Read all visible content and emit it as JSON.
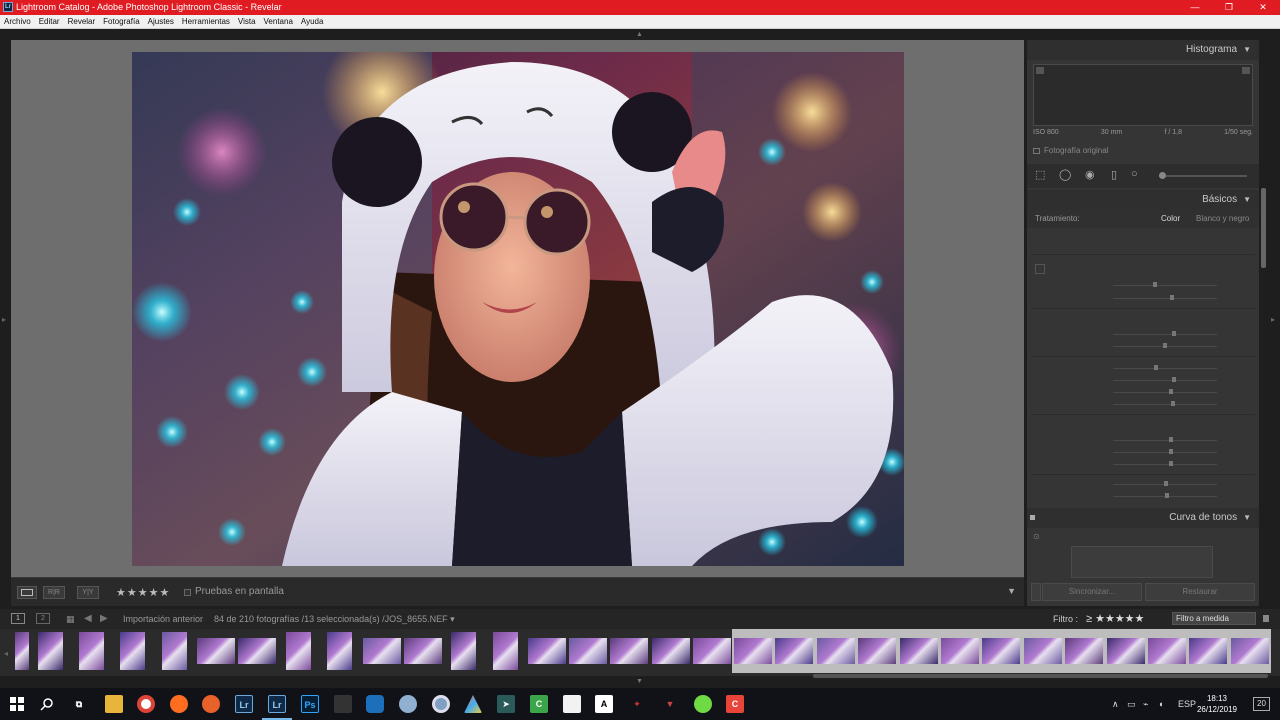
{
  "window": {
    "title": "Lightroom Catalog - Adobe Photoshop Lightroom Classic - Revelar",
    "app_icon": "Lr",
    "controls": [
      "—",
      "❐",
      "✕"
    ]
  },
  "menu": [
    "Archivo",
    "Editar",
    "Revelar",
    "Fotografía",
    "Ajustes",
    "Herramientas",
    "Vista",
    "Ventana",
    "Ayuda"
  ],
  "toolbar": {
    "rating": "★★★★★",
    "softproof_label": "Pruebas en pantalla",
    "view_grid": "R|R",
    "view_compare": "Y|Y"
  },
  "right_panel": {
    "histogram_title": "Histograma",
    "exif": [
      "ISO 800",
      "30 mm",
      "f / 1,8",
      "1/50 seg."
    ],
    "original_photo": "Fotografía original",
    "basics_title": "Básicos",
    "treatment_label": "Tratamiento:",
    "treatment_color": "Color",
    "treatment_bw": "Blanco y negro",
    "tone_curve_title": "Curva de tonos",
    "sync_button": "Sincronizar...",
    "reset_button": "Restaurar"
  },
  "filmstrip_bar": {
    "monitor1": "1",
    "monitor2": "2",
    "source": "Importación anterior",
    "count": "84 de 210 fotografías /13 seleccionada(s) /JOS_8655.NEF ▾",
    "filter_label": "Filtro :",
    "filter_rating": "≥ ★★★★★",
    "filter_preset": "Filtro a medida"
  },
  "taskbar": {
    "language": "ESP",
    "time": "18:13",
    "date": "26/12/2019",
    "notifications": "20",
    "icons": [
      "windows-start",
      "search",
      "task-view",
      "file-explorer",
      "chrome",
      "firefox",
      "firefox-2",
      "lightroom",
      "lightroom-classic",
      "photoshop",
      "app-dark",
      "app-cube",
      "app-globe",
      "app-disc",
      "app-prism",
      "app-arrow",
      "camtasia",
      "notepad",
      "font-app",
      "app-wolf",
      "app-red",
      "upwork",
      "camtasia-rec"
    ]
  },
  "colors": {
    "titlebar": "#e11b22",
    "panel_bg": "#353535",
    "canvas_bg": "#6e6e6e",
    "taskbar": "#101218"
  }
}
